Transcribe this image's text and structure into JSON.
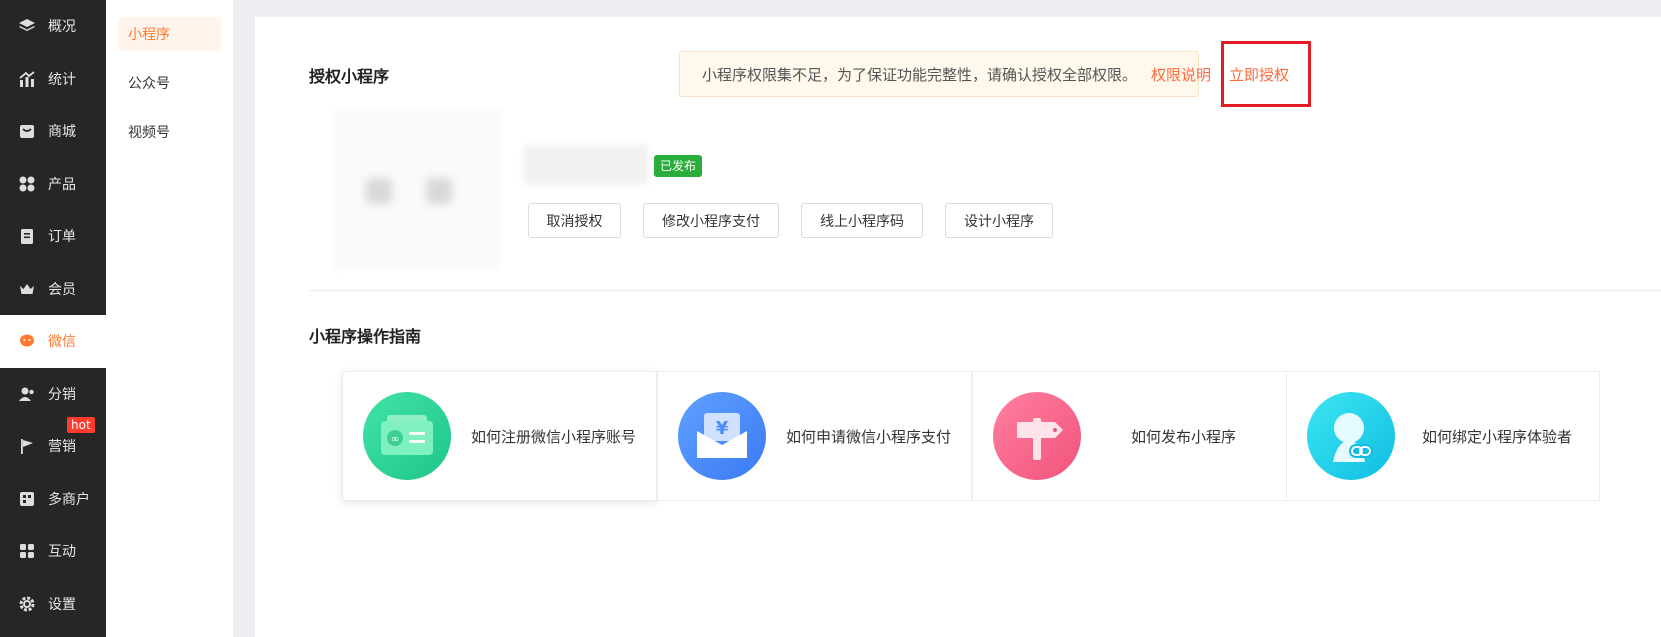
{
  "sidebar": {
    "items": [
      {
        "label": "概况",
        "icon": "layers-icon"
      },
      {
        "label": "统计",
        "icon": "chart-icon"
      },
      {
        "label": "商城",
        "icon": "shop-icon"
      },
      {
        "label": "产品",
        "icon": "product-icon"
      },
      {
        "label": "订单",
        "icon": "order-icon"
      },
      {
        "label": "会员",
        "icon": "crown-icon"
      },
      {
        "label": "微信",
        "icon": "wechat-icon"
      },
      {
        "label": "分销",
        "icon": "distribution-icon"
      },
      {
        "label": "营销",
        "icon": "flag-icon",
        "badge": "hot"
      },
      {
        "label": "多商户",
        "icon": "merchant-icon"
      },
      {
        "label": "互动",
        "icon": "interaction-icon"
      },
      {
        "label": "设置",
        "icon": "gear-icon"
      }
    ],
    "active_index": 6
  },
  "subnav": {
    "items": [
      "小程序",
      "公众号",
      "视频号"
    ],
    "active_index": 0
  },
  "auth": {
    "title": "授权小程序",
    "notice_text": "小程序权限集不足，为了保证功能完整性，请确认授权全部权限。",
    "notice_link": "权限说明",
    "notice_action": "立即授权",
    "status_badge": "已发布",
    "buttons": [
      "取消授权",
      "修改小程序支付",
      "线上小程序码",
      "设计小程序"
    ]
  },
  "guide": {
    "title": "小程序操作指南",
    "cards": [
      {
        "label": "如何注册微信小程序账号",
        "icon": "register-card-icon",
        "color_from": "#3ee0a0",
        "color_to": "#1fc98a"
      },
      {
        "label": "如何申请微信小程序支付",
        "icon": "payment-envelope-icon",
        "color_from": "#5b9bff",
        "color_to": "#3d7ef5"
      },
      {
        "label": "如何发布小程序",
        "icon": "signpost-icon",
        "color_from": "#ff7a99",
        "color_to": "#f4567f"
      },
      {
        "label": "如何绑定小程序体验者",
        "icon": "user-link-icon",
        "color_from": "#32e0f0",
        "color_to": "#12c4e6"
      }
    ]
  },
  "colors": {
    "accent": "#ff7a2e",
    "sidebar_bg": "#262626",
    "badge_green": "#2aae3b",
    "highlight_red": "#e21c24"
  }
}
